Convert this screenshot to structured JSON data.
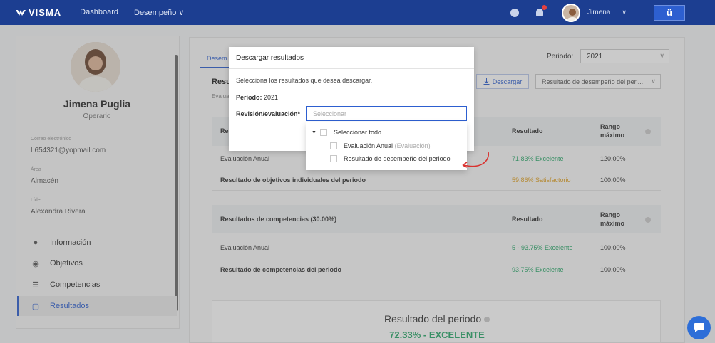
{
  "topbar": {
    "brand": "VISMA",
    "nav": [
      "Dashboard",
      "Desempeño"
    ],
    "nav_chevron": "∨",
    "user_name": "Jimena",
    "user_chevron": "∨",
    "app_button": "ü",
    "icons": [
      "help-icon",
      "notification-bell-icon"
    ]
  },
  "sidebar": {
    "name": "Jimena Puglia",
    "role": "Operario",
    "fields": [
      {
        "label": "Correo electrónico",
        "value": "L654321@yopmail.com"
      },
      {
        "label": "Área",
        "value": "Almacén"
      },
      {
        "label": "Líder",
        "value": "Alexandra Rivera"
      }
    ],
    "menu": [
      {
        "label": "Información",
        "icon": "user-icon"
      },
      {
        "label": "Objetivos",
        "icon": "target-icon"
      },
      {
        "label": "Competencias",
        "icon": "list-icon"
      },
      {
        "label": "Resultados",
        "icon": "clipboard-icon",
        "active": true
      }
    ]
  },
  "main": {
    "tab_label": "Desem",
    "periodo_label": "Periodo:",
    "periodo_value": "2021",
    "results_heading": "Resul",
    "eval_sub": "Evalua",
    "download_button": "Descargar",
    "result_select": "Resultado de desempeño del peri...",
    "table1": {
      "header_first": "Re",
      "header_result": "Resultado",
      "header_range": "Rango máximo",
      "rows": [
        {
          "name": "Evaluación Anual",
          "result": "71.83% Excelente",
          "range": "120.00%",
          "color": "#2aa86a",
          "bold": false
        },
        {
          "name": "Resultado de objetivos individuales del periodo",
          "result": "59.86% Satisfactorio",
          "range": "100.00%",
          "color": "#e0a020",
          "bold": true
        }
      ]
    },
    "table2": {
      "header_first": "Resultados de competencias (30.00%)",
      "header_result": "Resultado",
      "header_range": "Rango máximo",
      "rows": [
        {
          "name": "Evaluación Anual",
          "result": "5 - 93.75% Excelente",
          "range": "100.00%",
          "color": "#2aa86a",
          "bold": false
        },
        {
          "name": "Resultado de competencias del periodo",
          "result": "93.75% Excelente",
          "range": "100.00%",
          "color": "#2aa86a",
          "bold": true
        }
      ]
    },
    "summary_title": "Resultado del periodo",
    "summary_value": "72.33% - EXCELENTE"
  },
  "modal": {
    "title": "Descargar resultados",
    "description": "Selecciona los resultados que desea descargar.",
    "periodo_label": "Periodo:",
    "periodo_value": "2021",
    "revision_label": "Revisión/evaluación*",
    "placeholder": "Seleccionar",
    "options": {
      "select_all": "Seleccionar todo",
      "item1": "Evaluación Anual",
      "item1_sub": "(Evaluación)",
      "item2": "Resultado de desempeño del periodo"
    }
  },
  "colors": {
    "brand": "#1c3e91",
    "accent": "#2d5fd0",
    "success": "#2aa86a",
    "warning": "#e0a020",
    "annotation": "#d9312e"
  }
}
